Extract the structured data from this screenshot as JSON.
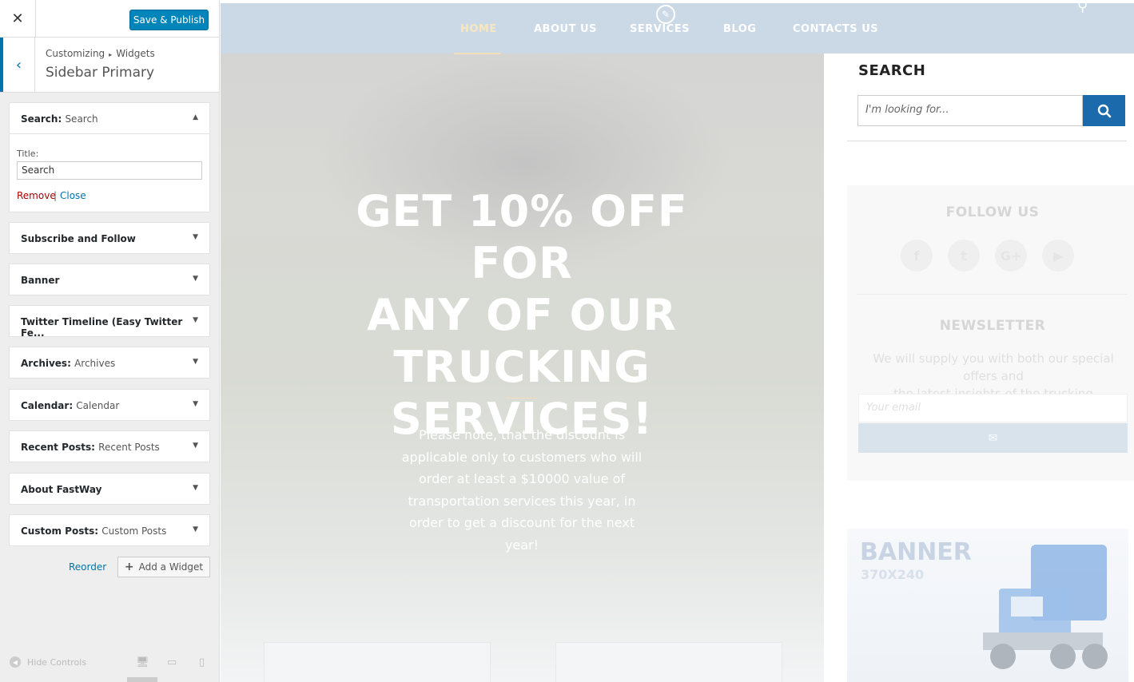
{
  "panel": {
    "save_label": "Save & Publish",
    "breadcrumb": [
      "Customizing",
      "Widgets"
    ],
    "section_title": "Sidebar Primary",
    "widgets": [
      {
        "name": "Search",
        "subtitle": "Search",
        "expanded": true
      },
      {
        "name": "Subscribe and Follow",
        "subtitle": ""
      },
      {
        "name": "Banner",
        "subtitle": ""
      },
      {
        "name": "Twitter Timeline (Easy Twitter Fe...",
        "subtitle": ""
      },
      {
        "name": "Archives",
        "subtitle": "Archives"
      },
      {
        "name": "Calendar",
        "subtitle": "Calendar"
      },
      {
        "name": "Recent Posts",
        "subtitle": "Recent Posts"
      },
      {
        "name": "About FastWay",
        "subtitle": ""
      },
      {
        "name": "Custom Posts",
        "subtitle": "Custom Posts"
      }
    ],
    "search_widget": {
      "title_label": "Title:",
      "title_value": "Search",
      "remove": "Remove",
      "close": "Close"
    },
    "reorder": "Reorder",
    "add_widget": "Add a Widget",
    "hide_controls": "Hide Controls"
  },
  "preview": {
    "nav": [
      "HOME",
      "ABOUT US",
      "SERVICES",
      "BLOG",
      "CONTACTS US"
    ],
    "active_nav": "HOME",
    "hero_title": [
      "GET 10% OFF FOR",
      "ANY OF OUR",
      "TRUCKING",
      "SERVICES!"
    ],
    "hero_text": [
      "Please note, that the discount is",
      "applicable only to customers who will",
      "order at least a $10000 value of",
      "transportation services this year, in",
      "order to get a discount for the next year!"
    ],
    "sidebar": {
      "search_title": "SEARCH",
      "search_placeholder": "I'm looking for...",
      "follow_title": "FOLLOW US",
      "newsletter_title": "NEWSLETTER",
      "newsletter_text": [
        "We will supply you with both our special offers and",
        "the latest insights of the trucking transportation!"
      ],
      "email_placeholder": "Your email",
      "banner_title": "BANNER",
      "banner_size": "370X240"
    }
  },
  "colors": {
    "accent": "#0085ba",
    "nav_bg": "#cbd9e6",
    "search_btn": "#1b6aab",
    "active_nav": "#f7e7bf"
  }
}
